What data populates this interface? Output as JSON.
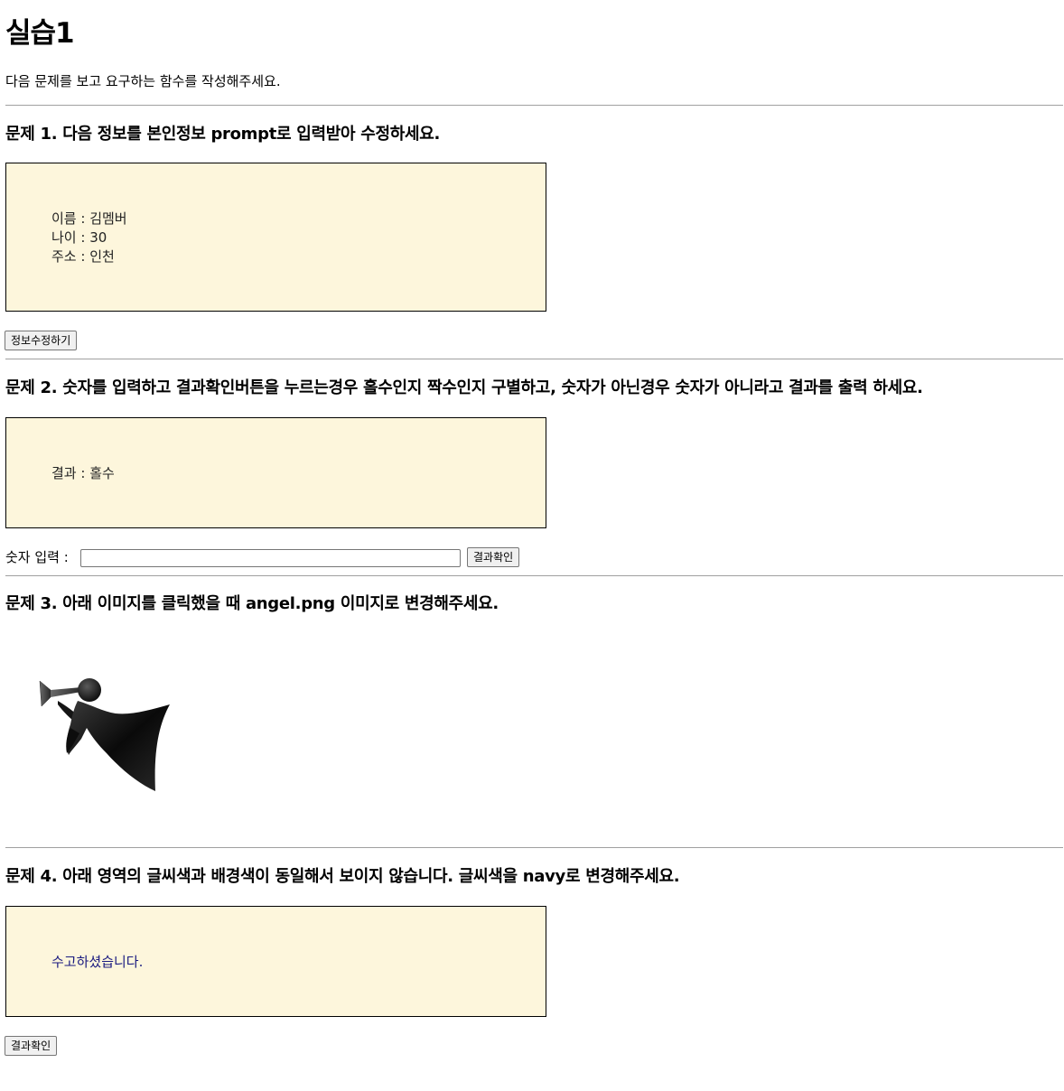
{
  "page": {
    "title": "실습1",
    "intro": "다음 문제를 보고 요구하는 함수를 작성해주세요."
  },
  "q1": {
    "heading": "문제 1. 다음 정보를 본인정보 prompt로 입력받아 수정하세요.",
    "name_line": "이름 : 김멤버",
    "age_line": "나이 : 30",
    "addr_line": "주소 : 인천",
    "button_label": "정보수정하기"
  },
  "q2": {
    "heading": "문제 2. 숫자를 입력하고 결과확인버튼을 누르는경우 홀수인지 짝수인지 구별하고, 숫자가 아닌경우 숫자가 아니라고 결과를 출력 하세요.",
    "result_line": "결과 : 홀수",
    "input_label": "숫자 입력 :",
    "input_value": "",
    "button_label": "결과확인"
  },
  "q3": {
    "heading": "문제 3. 아래 이미지를 클릭했을 때 angel.png 이미지로 변경해주세요.",
    "image_icon": "angel-trumpet-icon"
  },
  "q4": {
    "heading": "문제 4. 아래 영역의 글씨색과 배경색이 동일해서 보이지 않습니다. 글씨색을 navy로 변경해주세요.",
    "message": "수고하셨습니다.",
    "message_color": "#1a1a80",
    "button_label": "결과확인"
  },
  "colors": {
    "box_background": "#fdf6dc",
    "divider": "#a0a0a0"
  }
}
